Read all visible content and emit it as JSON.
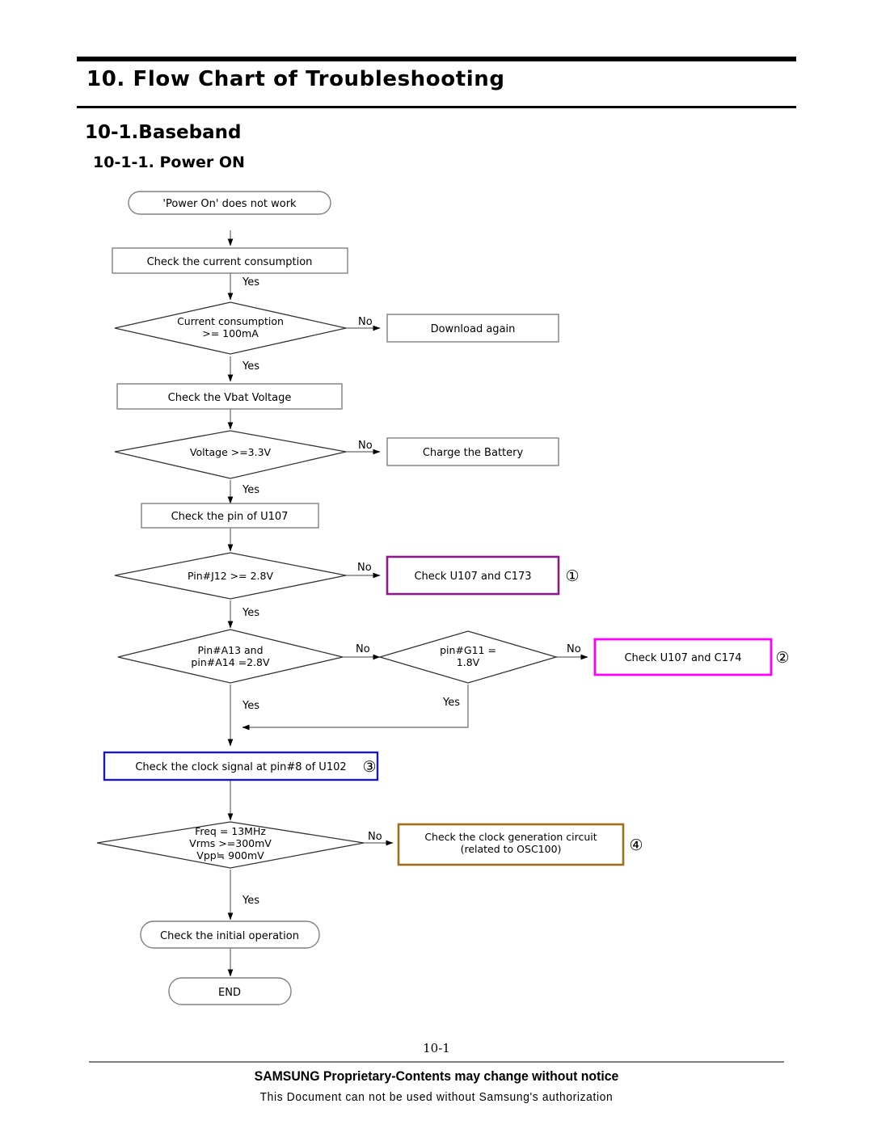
{
  "document": {
    "chapter_title": "10. Flow Chart of Troubleshooting",
    "section_title": "10-1.Baseband",
    "subsection_title": "10-1-1. Power ON",
    "page_number": "10-1",
    "footer_notice": "SAMSUNG Proprietary-Contents may change without notice",
    "footer_authorization": "This Document can not be used without Samsung's authorization"
  },
  "colors": {
    "default_stroke": "#808080",
    "diamond_stroke": "#333333",
    "text": "#000000",
    "purple": "#8B1A8B",
    "magenta": "#FF00FF",
    "blue": "#1A1AB0",
    "goldenrod": "#A0711A"
  },
  "chart_data": {
    "type": "diagram",
    "title": "10-1-1. Power ON",
    "nodes": [
      {
        "id": "start",
        "shape": "rounded-rect",
        "text": "'Power On' does not work",
        "color": "#808080"
      },
      {
        "id": "check-current",
        "shape": "rect",
        "text": "Check the current consumption",
        "color": "#808080"
      },
      {
        "id": "d-current",
        "shape": "diamond",
        "text": "Current consumption",
        "text2": ">=  100mA",
        "color": "#333333"
      },
      {
        "id": "download",
        "shape": "rect",
        "text": "Download again",
        "color": "#808080"
      },
      {
        "id": "check-vbat",
        "shape": "rect",
        "text": "Check the Vbat Voltage",
        "color": "#808080"
      },
      {
        "id": "d-voltage",
        "shape": "diamond",
        "text": "Voltage >=3.3V",
        "color": "#333333"
      },
      {
        "id": "charge",
        "shape": "rect",
        "text": "Charge the Battery",
        "color": "#808080"
      },
      {
        "id": "check-u107",
        "shape": "rect",
        "text": "Check the pin of U107",
        "color": "#808080"
      },
      {
        "id": "d-j12",
        "shape": "diamond",
        "text": "Pin#J12 >=  2.8V",
        "color": "#333333"
      },
      {
        "id": "check-c173",
        "shape": "rect",
        "text": "Check U107 and C173",
        "marker": "①",
        "color": "#8B1A8B"
      },
      {
        "id": "d-a13",
        "shape": "diamond",
        "text": "Pin#A13 and",
        "text2": "pin#A14 =2.8V",
        "color": "#333333"
      },
      {
        "id": "d-g11",
        "shape": "diamond",
        "text": "pin#G11 =",
        "text2": "1.8V",
        "color": "#333333"
      },
      {
        "id": "check-c174",
        "shape": "rect",
        "text": "Check U107 and C174",
        "marker": "②",
        "color": "#FF00FF"
      },
      {
        "id": "check-clock",
        "shape": "rect",
        "text": "Check the clock signal at pin#8 of U102",
        "marker": "③",
        "color": "#1A1AB0"
      },
      {
        "id": "d-freq",
        "shape": "diamond",
        "text": "Freq =  13MHz",
        "text2": "Vrms >=300mV",
        "text3": "Vpp≒ 900mV",
        "color": "#333333"
      },
      {
        "id": "check-osc",
        "shape": "rect",
        "text": "Check the clock generation circuit",
        "text2": "(related to OSC100)",
        "marker": "④",
        "color": "#A0711A"
      },
      {
        "id": "check-init",
        "shape": "rounded-rect",
        "text": "Check the initial operation",
        "color": "#808080"
      },
      {
        "id": "end",
        "shape": "rounded-rect",
        "text": "END",
        "color": "#808080"
      }
    ],
    "edges": [
      {
        "from": "start",
        "to": "check-current",
        "label": ""
      },
      {
        "from": "check-current",
        "to": "d-current",
        "label": "Yes"
      },
      {
        "from": "d-current",
        "to": "download",
        "label": "No"
      },
      {
        "from": "d-current",
        "to": "check-vbat",
        "label": "Yes"
      },
      {
        "from": "check-vbat",
        "to": "d-voltage",
        "label": ""
      },
      {
        "from": "d-voltage",
        "to": "charge",
        "label": "No"
      },
      {
        "from": "d-voltage",
        "to": "check-u107",
        "label": "Yes"
      },
      {
        "from": "check-u107",
        "to": "d-j12",
        "label": ""
      },
      {
        "from": "d-j12",
        "to": "check-c173",
        "label": "No"
      },
      {
        "from": "d-j12",
        "to": "d-a13",
        "label": "Yes"
      },
      {
        "from": "d-a13",
        "to": "d-g11",
        "label": "No"
      },
      {
        "from": "d-a13",
        "to": "check-clock",
        "label": "Yes"
      },
      {
        "from": "d-g11",
        "to": "check-c174",
        "label": "No"
      },
      {
        "from": "d-g11",
        "to": "check-clock",
        "label": "Yes"
      },
      {
        "from": "check-clock",
        "to": "d-freq",
        "label": ""
      },
      {
        "from": "d-freq",
        "to": "check-osc",
        "label": "No"
      },
      {
        "from": "d-freq",
        "to": "check-init",
        "label": "Yes"
      },
      {
        "from": "check-init",
        "to": "end",
        "label": ""
      }
    ]
  },
  "flow": {
    "labels": {
      "yes": "Yes",
      "no": "No"
    },
    "n_start": "'Power On' does not work",
    "n_check_current": "Check the current consumption",
    "n_d_current_1": "Current consumption",
    "n_d_current_2": ">=  100mA",
    "n_download": "Download again",
    "n_check_vbat": "Check the Vbat Voltage",
    "n_d_voltage": "Voltage >=3.3V",
    "n_charge": "Charge the Battery",
    "n_check_u107": "Check the pin of U107",
    "n_d_j12": "Pin#J12 >=  2.8V",
    "n_check_c173": "Check U107 and C173",
    "n_d_a13_1": "Pin#A13 and",
    "n_d_a13_2": "pin#A14 =2.8V",
    "n_d_g11_1": "pin#G11 =",
    "n_d_g11_2": "1.8V",
    "n_check_c174": "Check U107 and C174",
    "n_check_clock": "Check the clock signal at pin#8 of U102",
    "n_d_freq_1": "Freq =  13MHz",
    "n_d_freq_2": "Vrms >=300mV",
    "n_d_freq_3": "Vpp≒ 900mV",
    "n_check_osc_1": "Check the clock generation circuit",
    "n_check_osc_2": "(related to OSC100)",
    "n_check_init": "Check the initial operation",
    "n_end": "END",
    "marker_1": "①",
    "marker_2": "②",
    "marker_3": "③",
    "marker_4": "④",
    "edge_yes_1": "Yes",
    "edge_no_1": "No",
    "edge_yes_2": "Yes",
    "edge_no_2": "No",
    "edge_yes_3": "Yes",
    "edge_no_3": "No",
    "edge_yes_4": "Yes",
    "edge_no_4": "No",
    "edge_no_5": "No",
    "edge_yes_5": "Yes",
    "edge_no_6": "No",
    "edge_yes_6": "Yes"
  }
}
